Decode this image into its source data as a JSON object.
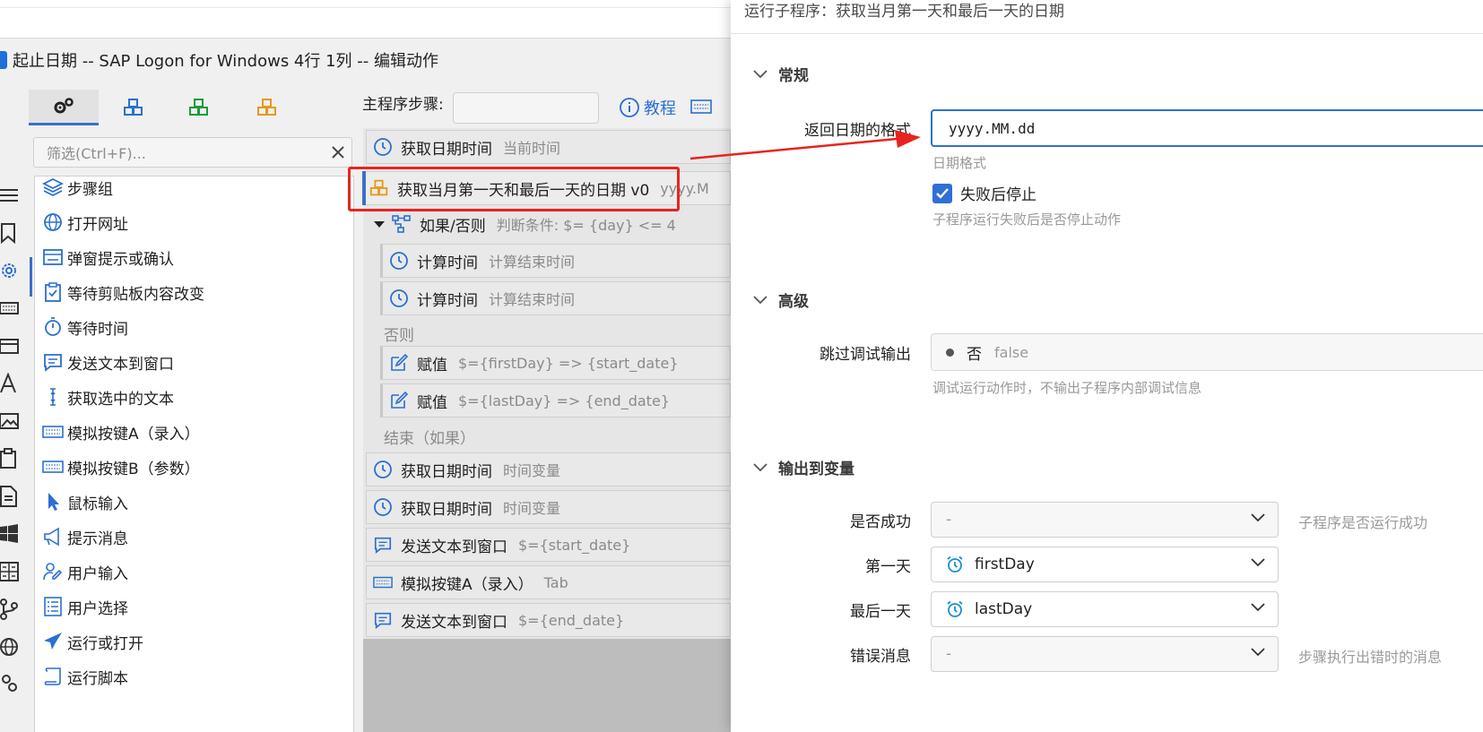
{
  "window": {
    "title": "起止日期 -- SAP Logon for Windows 4行 1列 -- 编辑动作"
  },
  "toolbox": {
    "filter_placeholder": "筛选(Ctrl+F)...",
    "actions": [
      {
        "label": "步骤组",
        "icon": "layers-icon"
      },
      {
        "label": "打开网址",
        "icon": "globe-icon"
      },
      {
        "label": "弹窗提示或确认",
        "icon": "dialog-icon"
      },
      {
        "label": "等待剪贴板内容改变",
        "icon": "clipboard-check-icon"
      },
      {
        "label": "等待时间",
        "icon": "stopwatch-icon"
      },
      {
        "label": "发送文本到窗口",
        "icon": "message-icon"
      },
      {
        "label": "获取选中的文本",
        "icon": "text-cursor-icon"
      },
      {
        "label": "模拟按键A（录入）",
        "icon": "keyboard-icon"
      },
      {
        "label": "模拟按键B（参数）",
        "icon": "keyboard-icon"
      },
      {
        "label": "鼠标输入",
        "icon": "mouse-pointer-icon"
      },
      {
        "label": "提示消息",
        "icon": "megaphone-icon"
      },
      {
        "label": "用户输入",
        "icon": "user-edit-icon"
      },
      {
        "label": "用户选择",
        "icon": "list-icon"
      },
      {
        "label": "运行或打开",
        "icon": "paper-plane-icon"
      },
      {
        "label": "运行脚本",
        "icon": "script-icon"
      }
    ]
  },
  "steps": {
    "label": "主程序步骤:",
    "tutorial_label": "教程",
    "items": [
      {
        "title": "获取日期时间",
        "desc": "当前时间"
      },
      {
        "title": "获取当月第一天和最后一天的日期 v0",
        "desc": "yyyy.M"
      },
      {
        "title": "如果/否则",
        "desc": "判断条件: $= {day} <= 4"
      },
      {
        "title": "计算时间",
        "desc": "计算结束时间"
      },
      {
        "title": "计算时间",
        "desc": "计算结束时间"
      },
      {
        "title": "赋值",
        "desc": "$={firstDay} => {start_date}"
      },
      {
        "title": "赋值",
        "desc": "$={lastDay} => {end_date}"
      },
      {
        "title": "获取日期时间",
        "desc": "时间变量"
      },
      {
        "title": "获取日期时间",
        "desc": "时间变量"
      },
      {
        "title": "发送文本到窗口",
        "desc": "$={start_date}"
      },
      {
        "title": "模拟按键A（录入）",
        "desc": "Tab"
      },
      {
        "title": "发送文本到窗口",
        "desc": "$={end_date}"
      }
    ],
    "else_label": "否则",
    "end_label": "结束（如果）"
  },
  "dialog": {
    "title": "运行子程序：获取当月第一天和最后一天的日期",
    "general": {
      "heading": "常规",
      "format_label": "返回日期的格式",
      "format_value": "yyyy.MM.dd",
      "format_hint": "日期格式",
      "stop_on_fail_label": "失败后停止",
      "stop_on_fail_checked": true,
      "stop_on_fail_hint": "子程序运行失败后是否停止动作"
    },
    "advanced": {
      "heading": "高级",
      "skip_label": "跳过调试输出",
      "skip_value": "否",
      "skip_sub": "false",
      "skip_hint": "调试运行动作时，不输出子程序内部调试信息"
    },
    "output": {
      "heading": "输出到变量",
      "success_label": "是否成功",
      "success_value": "-",
      "success_hint": "子程序是否运行成功",
      "first_label": "第一天",
      "first_value": "firstDay",
      "last_label": "最后一天",
      "last_value": "lastDay",
      "error_label": "错误消息",
      "error_value": "-",
      "error_hint": "步骤执行出错时的消息"
    }
  },
  "colors": {
    "accent": "#2f6fd6",
    "highlight": "#e8231e"
  }
}
